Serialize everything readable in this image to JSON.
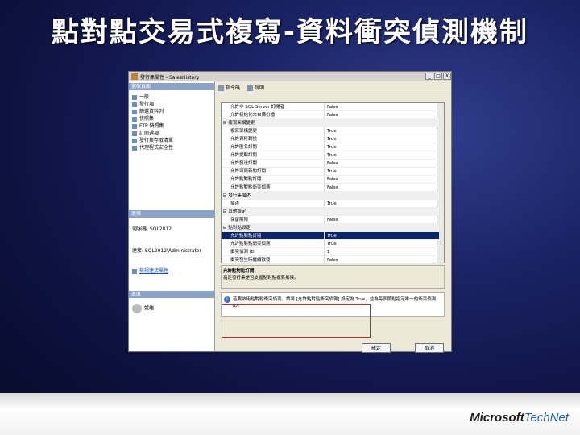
{
  "slide": {
    "title": "點對點交易式複寫-資料衝突偵測機制",
    "logo_ms": "Microsoft",
    "logo_tn": "TechNet"
  },
  "dialog": {
    "title": "發行集屬性 - SalesHistory",
    "win_buttons": [
      "_",
      "□",
      "X"
    ],
    "left": {
      "select_page_header": "選取頁面",
      "nav_items": [
        "一般",
        "發行項",
        "篩選資料列",
        "快照集",
        "FTP 快照集",
        "訂閱選項",
        "發行集存取清單",
        "代理程式安全性"
      ],
      "connection_header": "連接",
      "server_label": "伺服器: SQL2012",
      "connection_label": "連接: SQL2012\\Administrator",
      "view_link": "檢視連接屬性",
      "progress_header": "進度",
      "progress_status": "就緒"
    },
    "toolbar": {
      "script": "指令碼",
      "help": "說明"
    },
    "grid_rows": [
      {
        "type": "prop",
        "label": "允許非 SQL Server 訂閱者",
        "value": "False"
      },
      {
        "type": "prop",
        "label": "允許初始化來自備份檔",
        "value": "False"
      },
      {
        "type": "cat",
        "label": "複寫架構變更"
      },
      {
        "type": "prop",
        "label": "複寫架構變更",
        "value": "True"
      },
      {
        "type": "prop",
        "label": "允許資料轉換",
        "value": "True"
      },
      {
        "type": "prop",
        "label": "允許匿名訂閱",
        "value": "True"
      },
      {
        "type": "prop",
        "label": "允許提取訂閱",
        "value": "True"
      },
      {
        "type": "prop",
        "label": "允許發送訂閱",
        "value": "False"
      },
      {
        "type": "prop",
        "label": "允許可更新的訂閱",
        "value": "True"
      },
      {
        "type": "prop",
        "label": "允許點對點訂閱",
        "value": "False"
      },
      {
        "type": "prop",
        "label": "允許點對點衝突偵測",
        "value": "False"
      },
      {
        "type": "cat",
        "label": "發行集描述"
      },
      {
        "type": "prop",
        "label": "描述",
        "value": "True"
      },
      {
        "type": "cat",
        "label": "其他設定"
      },
      {
        "type": "prop",
        "label": "保留期限",
        "value": "False"
      },
      {
        "type": "cat",
        "label": "點對點設定"
      },
      {
        "type": "prop",
        "label": "允許點對點訂閱",
        "value": "True",
        "selected": true
      },
      {
        "type": "prop",
        "label": "允許點對點衝突偵測",
        "value": "True"
      },
      {
        "type": "prop",
        "label": "衝突偵測 ID",
        "value": "1"
      },
      {
        "type": "prop",
        "label": "衝突發生時繼續散發",
        "value": "False"
      }
    ],
    "description": {
      "title": "允許點對點訂閱",
      "text": "指定發行集是否支援點對點複寫拓撲。"
    },
    "info_text": "若要啟用點對點衝突偵測，請將 [允許點對點衝突偵測] 設定為 True，並為每個節點指定唯一的衝突偵測 ID。",
    "ok_button": "確定",
    "cancel_button": "取消"
  }
}
